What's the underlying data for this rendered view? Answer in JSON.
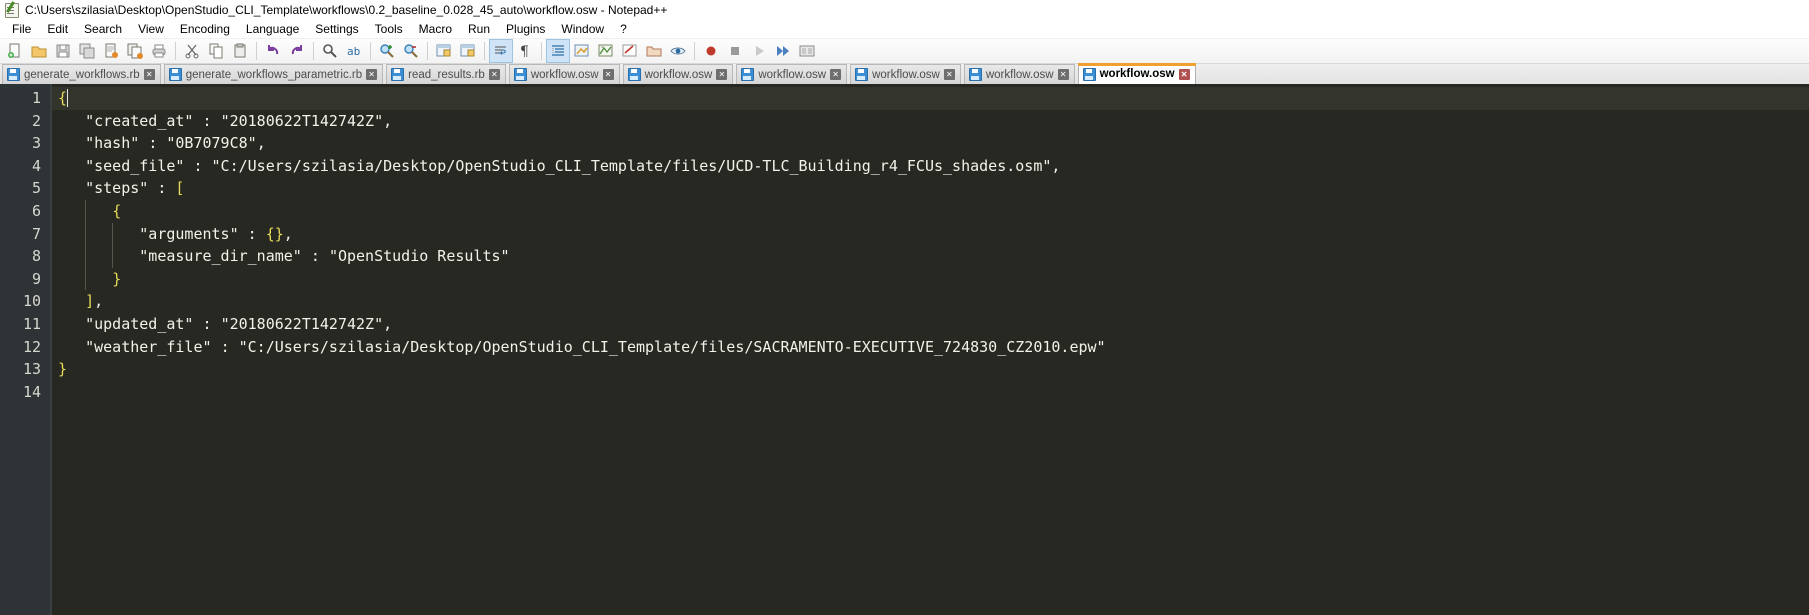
{
  "window": {
    "title": "C:\\Users\\szilasia\\Desktop\\OpenStudio_CLI_Template\\workflows\\0.2_baseline_0.028_45_auto\\workflow.osw - Notepad++",
    "app_icon": "notepad-plus-plus-icon"
  },
  "menu": {
    "items": [
      {
        "label": "File"
      },
      {
        "label": "Edit"
      },
      {
        "label": "Search"
      },
      {
        "label": "View"
      },
      {
        "label": "Encoding"
      },
      {
        "label": "Language"
      },
      {
        "label": "Settings"
      },
      {
        "label": "Tools"
      },
      {
        "label": "Macro"
      },
      {
        "label": "Run"
      },
      {
        "label": "Plugins"
      },
      {
        "label": "Window"
      },
      {
        "label": "?"
      }
    ]
  },
  "toolbar": {
    "buttons": [
      {
        "name": "new-file-icon",
        "glyph": "📄",
        "tip": "New"
      },
      {
        "name": "open-file-icon",
        "glyph": "📂",
        "tip": "Open"
      },
      {
        "name": "save-icon",
        "glyph": "💾",
        "tip": "Save"
      },
      {
        "name": "save-all-icon",
        "glyph": "🗂",
        "tip": "Save All"
      },
      {
        "name": "close-file-icon",
        "glyph": "📄",
        "tip": "Close"
      },
      {
        "name": "close-all-icon",
        "glyph": "🗐",
        "tip": "Close All"
      },
      {
        "name": "print-icon",
        "glyph": "🖶",
        "tip": "Print"
      },
      {
        "name": "separator-1",
        "glyph": "|",
        "tip": ""
      },
      {
        "name": "cut-icon",
        "glyph": "✂",
        "tip": "Cut"
      },
      {
        "name": "copy-icon",
        "glyph": "⧉",
        "tip": "Copy"
      },
      {
        "name": "paste-icon",
        "glyph": "📋",
        "tip": "Paste"
      },
      {
        "name": "separator-2",
        "glyph": "|",
        "tip": ""
      },
      {
        "name": "undo-icon",
        "glyph": "↩",
        "tip": "Undo"
      },
      {
        "name": "redo-icon",
        "glyph": "↪",
        "tip": "Redo"
      },
      {
        "name": "separator-3",
        "glyph": "|",
        "tip": ""
      },
      {
        "name": "find-icon",
        "glyph": "🔍",
        "tip": "Find"
      },
      {
        "name": "replace-icon",
        "glyph": "ab",
        "tip": "Replace"
      },
      {
        "name": "separator-4",
        "glyph": "|",
        "tip": ""
      },
      {
        "name": "zoom-in-icon",
        "glyph": "🔍",
        "tip": "Zoom In"
      },
      {
        "name": "zoom-out-icon",
        "glyph": "🔍",
        "tip": "Zoom Out"
      },
      {
        "name": "separator-5",
        "glyph": "|",
        "tip": ""
      },
      {
        "name": "sync-vertical-scroll-icon",
        "glyph": "🗗",
        "tip": "Synchronize Vertical Scrolling"
      },
      {
        "name": "sync-horizontal-scroll-icon",
        "glyph": "🗗",
        "tip": "Synchronize Horizontal Scrolling"
      },
      {
        "name": "separator-6",
        "glyph": "|",
        "tip": ""
      },
      {
        "name": "word-wrap-icon",
        "glyph": "⏎",
        "tip": "Word Wrap"
      },
      {
        "name": "show-all-characters-icon",
        "glyph": "¶",
        "tip": "Show All Characters"
      },
      {
        "name": "separator-7",
        "glyph": "|",
        "tip": ""
      },
      {
        "name": "indent-guide-icon",
        "glyph": "⋮≡",
        "tip": "Show Indent Guide"
      },
      {
        "name": "user-defined-language-icon",
        "glyph": "🗔",
        "tip": "User Defined Dialogue"
      },
      {
        "name": "document-map-icon",
        "glyph": "🗺",
        "tip": "Document Map"
      },
      {
        "name": "function-list-icon",
        "glyph": "✏",
        "tip": "Function List"
      },
      {
        "name": "folder-workspace-icon",
        "glyph": "🗀",
        "tip": "Folder as Workspace"
      },
      {
        "name": "monitoring-icon",
        "glyph": "👁",
        "tip": "Monitoring"
      },
      {
        "name": "separator-8",
        "glyph": "|",
        "tip": ""
      },
      {
        "name": "record-macro-icon",
        "glyph": "●",
        "tip": "Start Recording"
      },
      {
        "name": "stop-macro-icon",
        "glyph": "■",
        "tip": "Stop Recording"
      },
      {
        "name": "play-macro-icon",
        "glyph": "▶",
        "tip": "Playback"
      },
      {
        "name": "run-macro-multiple-icon",
        "glyph": "⏩",
        "tip": "Run a Macro Multiple Times"
      },
      {
        "name": "save-macro-icon",
        "glyph": "🖩",
        "tip": "Save Currently Recorded Macro"
      }
    ]
  },
  "tabs": [
    {
      "label": "generate_workflows.rb",
      "active": false
    },
    {
      "label": "generate_workflows_parametric.rb",
      "active": false
    },
    {
      "label": "read_results.rb",
      "active": false
    },
    {
      "label": "workflow.osw",
      "active": false
    },
    {
      "label": "workflow.osw",
      "active": false
    },
    {
      "label": "workflow.osw",
      "active": false
    },
    {
      "label": "workflow.osw",
      "active": false
    },
    {
      "label": "workflow.osw",
      "active": false
    },
    {
      "label": "workflow.osw",
      "active": true
    }
  ],
  "editor": {
    "current_line": 1,
    "line_count": 14,
    "colors": {
      "background": "#272822",
      "gutter_background": "#2e3436",
      "gutter_text": "#d6d8cf",
      "text": "#e8e8e0",
      "brace": "#e6db5a",
      "current_line_highlight": "#33342b",
      "active_tab_accent": "#f0a030"
    },
    "line_numbers": [
      "1",
      "2",
      "3",
      "4",
      "5",
      "6",
      "7",
      "8",
      "9",
      "10",
      "11",
      "12",
      "13",
      "14"
    ],
    "lines": [
      {
        "n": 1,
        "indent": 0,
        "text": "{"
      },
      {
        "n": 2,
        "indent": 0,
        "text": "   \"created_at\" : \"20180622T142742Z\","
      },
      {
        "n": 3,
        "indent": 0,
        "text": "   \"hash\" : \"0B7079C8\","
      },
      {
        "n": 4,
        "indent": 0,
        "text": "   \"seed_file\" : \"C:/Users/szilasia/Desktop/OpenStudio_CLI_Template/files/UCD-TLC_Building_r4_FCUs_shades.osm\","
      },
      {
        "n": 5,
        "indent": 0,
        "text": "   \"steps\" : ["
      },
      {
        "n": 6,
        "indent": 0,
        "text": "      {"
      },
      {
        "n": 7,
        "indent": 0,
        "text": "         \"arguments\" : {},"
      },
      {
        "n": 8,
        "indent": 0,
        "text": "         \"measure_dir_name\" : \"OpenStudio Results\""
      },
      {
        "n": 9,
        "indent": 0,
        "text": "      }"
      },
      {
        "n": 10,
        "indent": 0,
        "text": "   ],"
      },
      {
        "n": 11,
        "indent": 0,
        "text": "   \"updated_at\" : \"20180622T142742Z\","
      },
      {
        "n": 12,
        "indent": 0,
        "text": "   \"weather_file\" : \"C:/Users/szilasia/Desktop/OpenStudio_CLI_Template/files/SACRAMENTO-EXECUTIVE_724830_CZ2010.epw\""
      },
      {
        "n": 13,
        "indent": 0,
        "text": "}"
      },
      {
        "n": 14,
        "indent": 0,
        "text": ""
      }
    ]
  }
}
